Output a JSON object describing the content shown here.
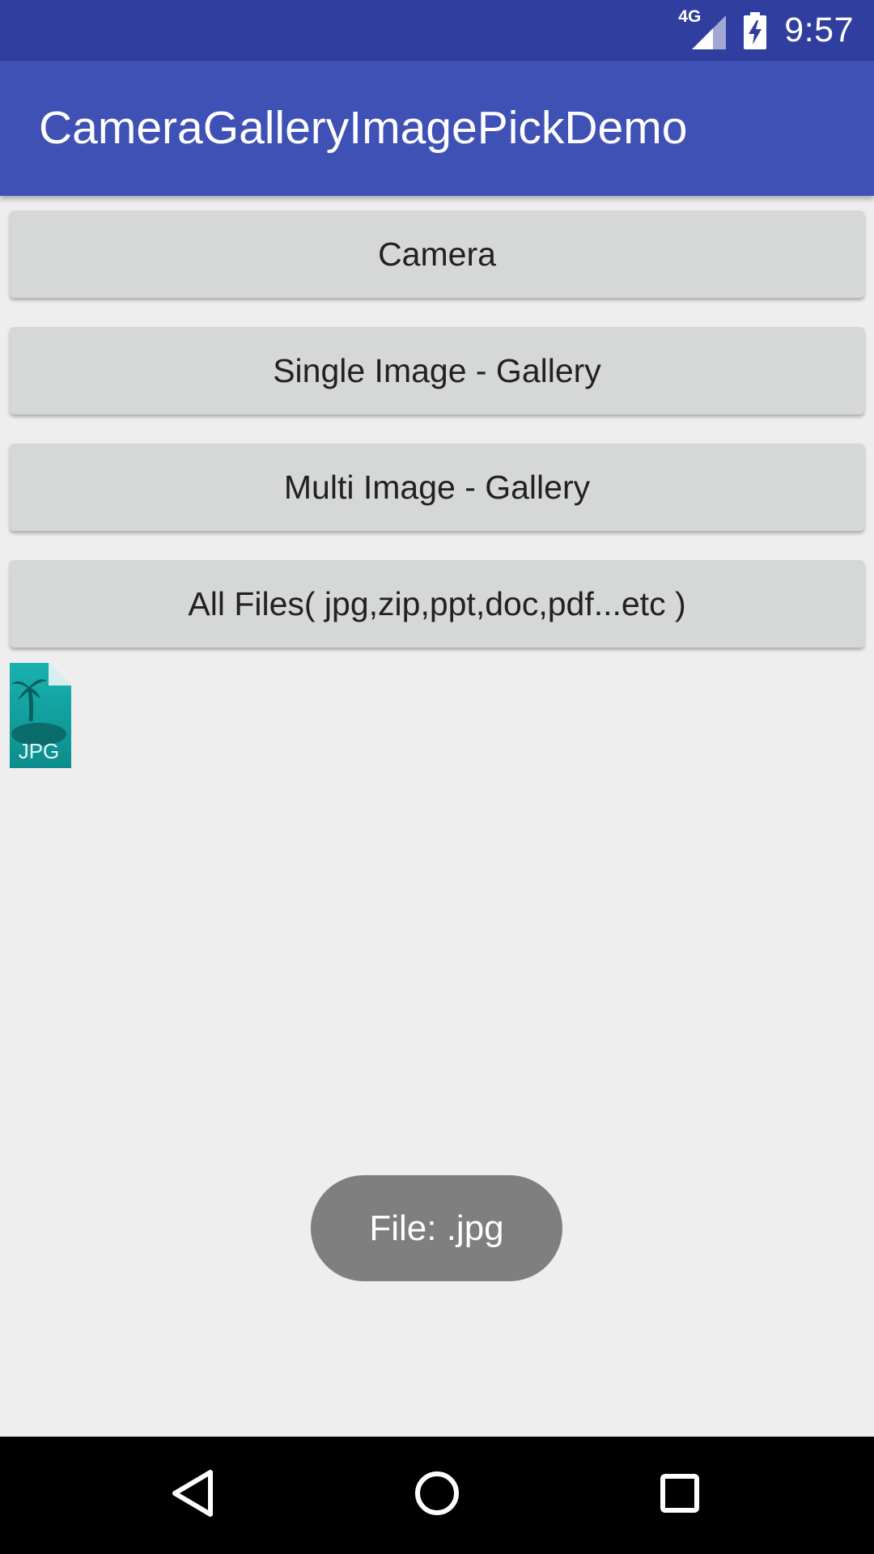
{
  "status_bar": {
    "network": "4G",
    "time": "9:57",
    "icons": [
      "signal-4g-icon",
      "battery-charging-icon"
    ]
  },
  "app_bar": {
    "title": "CameraGalleryImagePickDemo"
  },
  "buttons": {
    "camera": "Camera",
    "single_gallery": "Single Image - Gallery",
    "multi_gallery": "Multi Image - Gallery",
    "all_files": "All Files( jpg,zip,ppt,doc,pdf...etc )"
  },
  "file_preview": {
    "icon": "jpg-file-icon",
    "badge_text": "JPG"
  },
  "toast": {
    "message": "File: .jpg"
  },
  "nav_bar": {
    "icons": [
      "back-icon",
      "home-icon",
      "recent-apps-icon"
    ]
  },
  "colors": {
    "status_bar": "#303f9f",
    "app_bar": "#3f51b5",
    "background": "#eeeeee",
    "button": "#d6d7d7",
    "toast": "#7f7f7f",
    "file_icon": "#109a9a"
  }
}
